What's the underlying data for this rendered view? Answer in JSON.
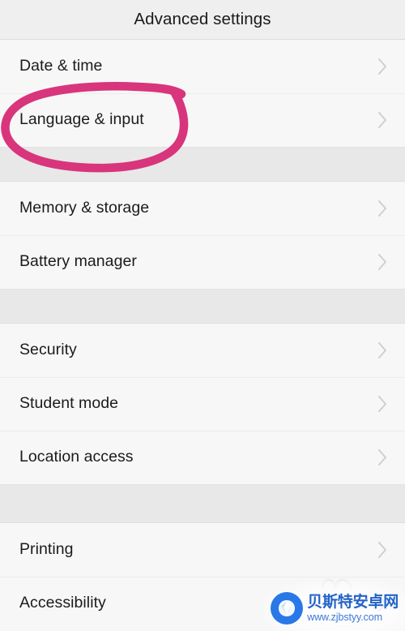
{
  "header": {
    "title": "Advanced settings"
  },
  "colors": {
    "annotation_pink": "#d8357c",
    "row_background": "#f7f7f7",
    "group_gap": "#e8e8e9",
    "header_background": "#efeff0",
    "chevron": "#c9c9c9",
    "watermark_blue": "#2878e8"
  },
  "list": {
    "groups": [
      {
        "rows": [
          {
            "label": "Date & time",
            "chevron": "chevron-right-icon",
            "annotated": false
          },
          {
            "label": "Language & input",
            "chevron": "chevron-right-icon",
            "annotated": true
          }
        ]
      },
      {
        "rows": [
          {
            "label": "Memory & storage",
            "chevron": "chevron-right-icon",
            "annotated": false
          },
          {
            "label": "Battery manager",
            "chevron": "chevron-right-icon",
            "annotated": false
          }
        ]
      },
      {
        "rows": [
          {
            "label": "Security",
            "chevron": "chevron-right-icon",
            "annotated": false
          },
          {
            "label": "Student mode",
            "chevron": "chevron-right-icon",
            "annotated": false
          },
          {
            "label": "Location access",
            "chevron": "chevron-right-icon",
            "annotated": false
          }
        ]
      },
      {
        "rows": [
          {
            "label": "Printing",
            "chevron": "chevron-right-icon",
            "annotated": false
          },
          {
            "label": "Accessibility",
            "chevron": "chevron-right-icon",
            "annotated": false
          }
        ]
      }
    ]
  },
  "annotation": {
    "shape": "hand-drawn-ellipse",
    "target": "Language & input"
  },
  "watermark": {
    "logo_icon": "diamond-gem-icon",
    "site_name": "贝斯特安卓网",
    "url": "www.zjbstyy.com"
  }
}
